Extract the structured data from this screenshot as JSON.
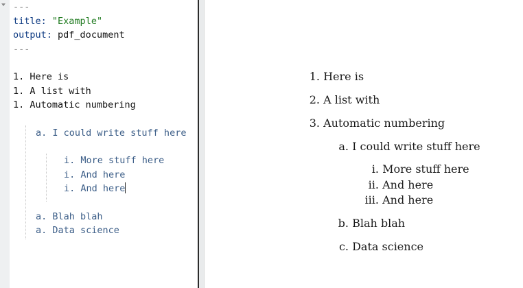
{
  "editor": {
    "yaml_dash_open": "---",
    "title_key": "title:",
    "title_value": "\"Example\"",
    "output_key": "output:",
    "output_value": "pdf_document",
    "yaml_dash_close": "---",
    "lines": [
      "1. Here is",
      "1. A list with",
      "1. Automatic numbering",
      "a. I could write stuff here",
      "i. More stuff here",
      "i. And here",
      "i. And here",
      "a. Blah blah",
      "a. Data science"
    ]
  },
  "preview": {
    "items": [
      {
        "num": "1.",
        "text": "Here is"
      },
      {
        "num": "2.",
        "text": "A list with"
      },
      {
        "num": "3.",
        "text": "Automatic numbering"
      },
      {
        "num": "a.",
        "text": "I could write stuff here"
      },
      {
        "num": "i.",
        "text": "More stuff here"
      },
      {
        "num": "ii.",
        "text": "And here"
      },
      {
        "num": "iii.",
        "text": "And here"
      },
      {
        "num": "b.",
        "text": "Blah blah"
      },
      {
        "num": "c.",
        "text": "Data science"
      }
    ]
  },
  "colors": {
    "yaml_key": "#0d3a82",
    "yaml_string": "#1f7a1f",
    "list_text": "#3b5d87",
    "gutter": "#eef0f1"
  }
}
